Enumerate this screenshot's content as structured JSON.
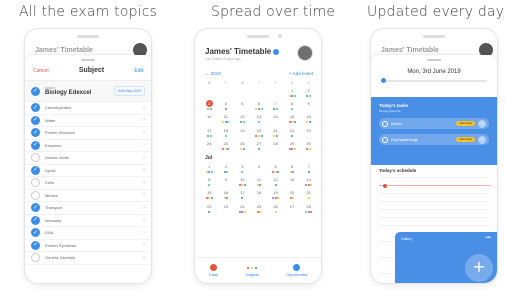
{
  "headings": [
    "All the exam topics",
    "Spread over time",
    "Updated every day"
  ],
  "colors": {
    "accent": "#3a8de8",
    "red": "#e5533d",
    "yellow": "#f6c22c",
    "green": "#4fc59a",
    "purple": "#9b6be0"
  },
  "phone1": {
    "peek_title": "James' Timetable",
    "cancel": "Cancel",
    "title": "Subject",
    "edit": "Edit",
    "selected": {
      "small": "Award",
      "name": "Biology Edexcel",
      "button": "Until May 2020"
    },
    "topics": [
      {
        "label": "Carbohydrates",
        "checked": true
      },
      {
        "label": "Water",
        "checked": true
      },
      {
        "label": "Protein Structure",
        "checked": true
      },
      {
        "label": "Enzymes",
        "checked": true
      },
      {
        "label": "Nucleic Acids",
        "checked": false
      },
      {
        "label": "Lipids",
        "checked": true
      },
      {
        "label": "Cells",
        "checked": false
      },
      {
        "label": "Mitosis",
        "checked": false
      },
      {
        "label": "Transport",
        "checked": true
      },
      {
        "label": "Immunity",
        "checked": true
      },
      {
        "label": "DNA",
        "checked": true
      },
      {
        "label": "Protein Synthesis",
        "checked": true
      },
      {
        "label": "Genetic Diversity",
        "checked": false
      }
    ]
  },
  "phone2": {
    "name": "James' Timetable",
    "subtitle": "Last Edited 2 days ago",
    "nav_prev": "← 2019",
    "nav_add": "+ Add event",
    "day_names": [
      "M",
      "T",
      "W",
      "T",
      "F",
      "S",
      "S"
    ],
    "second_month": "Jul",
    "weeks1": [
      [
        "",
        "",
        "",
        "",
        "",
        "1",
        "2"
      ],
      [
        "3",
        "4",
        "5",
        "6",
        "7",
        "8",
        "9"
      ],
      [
        "10",
        "11",
        "12",
        "13",
        "14",
        "15",
        "16"
      ],
      [
        "17",
        "18",
        "19",
        "20",
        "21",
        "22",
        "23"
      ],
      [
        "24",
        "25",
        "26",
        "27",
        "28",
        "29",
        "30"
      ]
    ],
    "weeks2": [
      [
        "1",
        "2",
        "3",
        "4",
        "5",
        "6",
        "7"
      ],
      [
        "8",
        "9",
        "10",
        "11",
        "12",
        "13",
        "14"
      ],
      [
        "15",
        "16",
        "17",
        "18",
        "19",
        "20",
        "21"
      ],
      [
        "22",
        "23",
        "24",
        "25",
        "26",
        "27",
        "28"
      ]
    ],
    "tabs": [
      "Today",
      "Subjects",
      "Opportunities"
    ]
  },
  "phone3": {
    "peek_title": "James' Timetable",
    "date": "Mon, 3rd June 2019",
    "tasks_title": "Today's tasks",
    "tasks_sub": "Biology Edexcel",
    "tasks": [
      {
        "label": "Mitosis",
        "badge": "Add to plan"
      },
      {
        "label": "Psychopathology",
        "badge": "Add to plan"
      }
    ],
    "schedule_title": "Today's schedule",
    "card_label": "Gallery",
    "card_more": "•••",
    "plus": "+"
  }
}
